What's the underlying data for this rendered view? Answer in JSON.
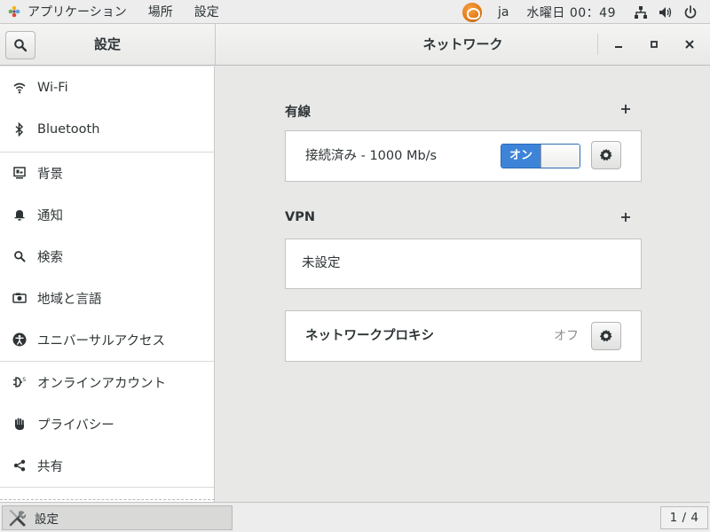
{
  "top_panel": {
    "apps_menu": "アプリケーション",
    "places_menu": "場所",
    "settings_menu": "設定",
    "input_language": "ja",
    "clock": "水曜日 00：49"
  },
  "header": {
    "sidebar_title": "設定",
    "title": "ネットワーク"
  },
  "sidebar": {
    "items": [
      {
        "label": "Wi-Fi",
        "icon": "wifi-icon"
      },
      {
        "label": "Bluetooth",
        "icon": "bluetooth-icon"
      },
      {
        "label": "背景",
        "icon": "background-icon"
      },
      {
        "label": "通知",
        "icon": "bell-icon"
      },
      {
        "label": "検索",
        "icon": "search-icon"
      },
      {
        "label": "地域と言語",
        "icon": "region-icon"
      },
      {
        "label": "ユニバーサルアクセス",
        "icon": "accessibility-icon"
      },
      {
        "label": "オンラインアカウント",
        "icon": "online-accounts-icon"
      },
      {
        "label": "プライバシー",
        "icon": "hand-icon"
      },
      {
        "label": "共有",
        "icon": "share-icon"
      }
    ]
  },
  "wired": {
    "title": "有線",
    "status": "接続済み - 1000 Mb/s",
    "switch_label": "オン",
    "switch_state": "on"
  },
  "vpn": {
    "title": "VPN",
    "empty_label": "未設定"
  },
  "proxy": {
    "label": "ネットワークプロキシ",
    "status": "オフ"
  },
  "taskbar": {
    "task_label": "設定",
    "pager": "1 / 4"
  },
  "colors": {
    "accent": "#3d84d9",
    "background": "#e8e8e7",
    "sidebar_bg": "#ffffff"
  }
}
